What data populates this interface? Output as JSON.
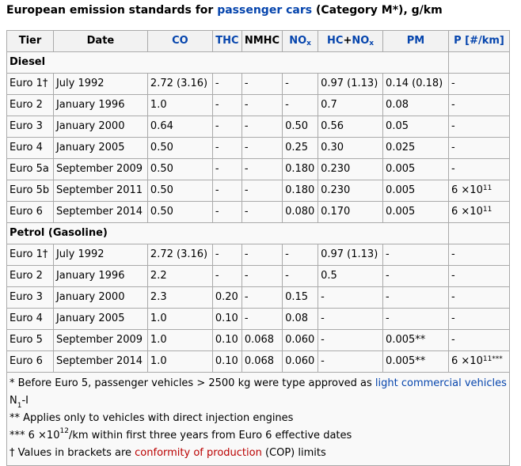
{
  "caption": {
    "prefix": "European emission standards for ",
    "link": "passenger cars",
    "suffix": " (Category M*), g/km"
  },
  "headers": {
    "tier": "Tier",
    "date": "Date",
    "co": "CO",
    "thc": "THC",
    "nmhc": "NMHC",
    "nox_main": "NO",
    "nox_sub": "x",
    "hcnox_hc": "HC",
    "hcnox_plus": "+",
    "hcnox_no": "NO",
    "hcnox_sub": "x",
    "pm": "PM",
    "p": "P [#/km]"
  },
  "sections": {
    "diesel": "Diesel",
    "petrol": "Petrol (Gasoline)"
  },
  "diesel_rows": [
    {
      "tier": "Euro 1†",
      "date": "July 1992",
      "co": "2.72 (3.16)",
      "thc": "-",
      "nmhc": "-",
      "nox": "-",
      "hcnox": "0.97 (1.13)",
      "pm": "0.14 (0.18)",
      "p": "-"
    },
    {
      "tier": "Euro 2",
      "date": "January 1996",
      "co": "1.0",
      "thc": "-",
      "nmhc": "-",
      "nox": "-",
      "hcnox": "0.7",
      "pm": "0.08",
      "p": "-"
    },
    {
      "tier": "Euro 3",
      "date": "January 2000",
      "co": "0.64",
      "thc": "-",
      "nmhc": "-",
      "nox": "0.50",
      "hcnox": "0.56",
      "pm": "0.05",
      "p": "-"
    },
    {
      "tier": "Euro 4",
      "date": "January 2005",
      "co": "0.50",
      "thc": "-",
      "nmhc": "-",
      "nox": "0.25",
      "hcnox": "0.30",
      "pm": "0.025",
      "p": "-"
    },
    {
      "tier": "Euro 5a",
      "date": "September 2009",
      "co": "0.50",
      "thc": "-",
      "nmhc": "-",
      "nox": "0.180",
      "hcnox": "0.230",
      "pm": "0.005",
      "p": "-"
    },
    {
      "tier": "Euro 5b",
      "date": "September 2011",
      "co": "0.50",
      "thc": "-",
      "nmhc": "-",
      "nox": "0.180",
      "hcnox": "0.230",
      "pm": "0.005",
      "p_base": "6 ×10",
      "p_exp": "11"
    },
    {
      "tier": "Euro 6",
      "date": "September 2014",
      "co": "0.50",
      "thc": "-",
      "nmhc": "-",
      "nox": "0.080",
      "hcnox": "0.170",
      "pm": "0.005",
      "p_base": "6 ×10",
      "p_exp": "11"
    }
  ],
  "petrol_rows": [
    {
      "tier": "Euro 1†",
      "date": "July 1992",
      "co": "2.72 (3.16)",
      "thc": "-",
      "nmhc": "-",
      "nox": "-",
      "hcnox": "0.97 (1.13)",
      "pm": "-",
      "p": "-"
    },
    {
      "tier": "Euro 2",
      "date": "January 1996",
      "co": "2.2",
      "thc": "-",
      "nmhc": "-",
      "nox": "-",
      "hcnox": "0.5",
      "pm": "-",
      "p": "-"
    },
    {
      "tier": "Euro 3",
      "date": "January 2000",
      "co": "2.3",
      "thc": "0.20",
      "nmhc": "-",
      "nox": "0.15",
      "hcnox": "-",
      "pm": "-",
      "p": "-"
    },
    {
      "tier": "Euro 4",
      "date": "January 2005",
      "co": "1.0",
      "thc": "0.10",
      "nmhc": "-",
      "nox": "0.08",
      "hcnox": "-",
      "pm": "-",
      "p": "-"
    },
    {
      "tier": "Euro 5",
      "date": "September 2009",
      "co": "1.0",
      "thc": "0.10",
      "nmhc": "0.068",
      "nox": "0.060",
      "hcnox": "-",
      "pm": "0.005**",
      "p": "-"
    },
    {
      "tier": "Euro 6",
      "date": "September 2014",
      "co": "1.0",
      "thc": "0.10",
      "nmhc": "0.068",
      "nox": "0.060",
      "hcnox": "-",
      "pm": "0.005**",
      "p_base": "6 ×10",
      "p_exp": "11",
      "p_suffix": "***"
    }
  ],
  "footnotes": {
    "f1_prefix": "* Before Euro 5, passenger vehicles > 2500 kg were type approved as ",
    "f1_link": "light commercial vehicles",
    "f1_n": " N",
    "f1_sub": "1",
    "f1_suffix": "-I",
    "f2": "** Applies only to vehicles with direct injection engines",
    "f3_prefix": "*** 6 ×10",
    "f3_exp": "12",
    "f3_suffix": "/km within first three years from Euro 6 effective dates",
    "f4_prefix": "† Values in brackets are ",
    "f4_link": "conformity of production",
    "f4_suffix": " (COP) limits"
  }
}
